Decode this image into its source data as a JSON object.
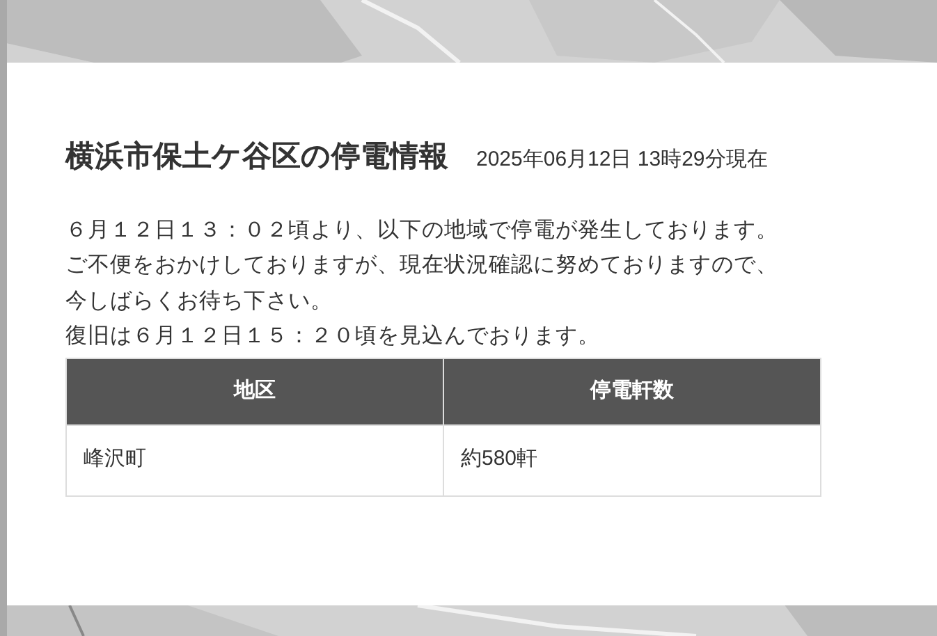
{
  "dialog": {
    "title": "横浜市保土ケ谷区の停電情報",
    "timestamp": "2025年06月12日 13時29分現在",
    "message_lines": [
      "６月１２日１３：０２頃より、以下の地域で停電が発生しております。",
      "ご不便をおかけしておりますが、現在状況確認に努めておりますので、",
      "今しばらくお待ち下さい。",
      "復旧は６月１２日１５：２０頃を見込んでおります。"
    ],
    "table": {
      "columns": [
        "地区",
        "停電軒数"
      ],
      "rows": [
        [
          "峰沢町",
          "約580軒"
        ]
      ]
    }
  }
}
